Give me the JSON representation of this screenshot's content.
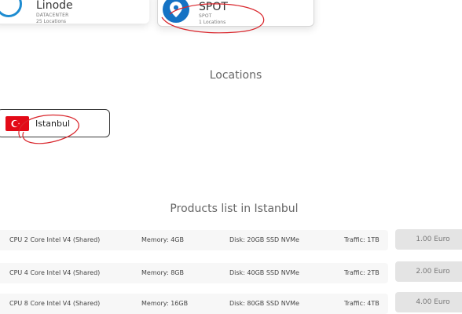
{
  "providers": [
    {
      "name": "Linode",
      "type": "DATACENTER",
      "count": "25 Locations",
      "icon": "linode-logo-icon",
      "accent": "#1e8cd1"
    },
    {
      "name": "SPOT",
      "type": "SPOT",
      "count": "1 Locations",
      "icon": "map-pin-icon",
      "accent": "#1472c4"
    }
  ],
  "locations_title": "Locations",
  "location": {
    "label": "Istanbul",
    "flag": "turkey-flag-icon",
    "flag_color": "#e30a17"
  },
  "products_title": "Products list in Istanbul",
  "products": [
    {
      "cpu": "CPU 2 Core Intel V4 (Shared)",
      "memory": "Memory: 4GB",
      "disk": "Disk: 20GB SSD NVMe",
      "traffic": "Traffic: 1TB",
      "price": "1.00 Euro"
    },
    {
      "cpu": "CPU 4 Core Intel V4 (Shared)",
      "memory": "Memory: 8GB",
      "disk": "Disk: 40GB SSD NVMe",
      "traffic": "Traffic: 2TB",
      "price": "2.00 Euro"
    },
    {
      "cpu": "CPU 8 Core Intel V4 (Shared)",
      "memory": "Memory: 16GB",
      "disk": "Disk: 80GB SSD NVMe",
      "traffic": "Traffic: 4TB",
      "price": "4.00 Euro"
    }
  ],
  "annotation_color": "#d9262c"
}
